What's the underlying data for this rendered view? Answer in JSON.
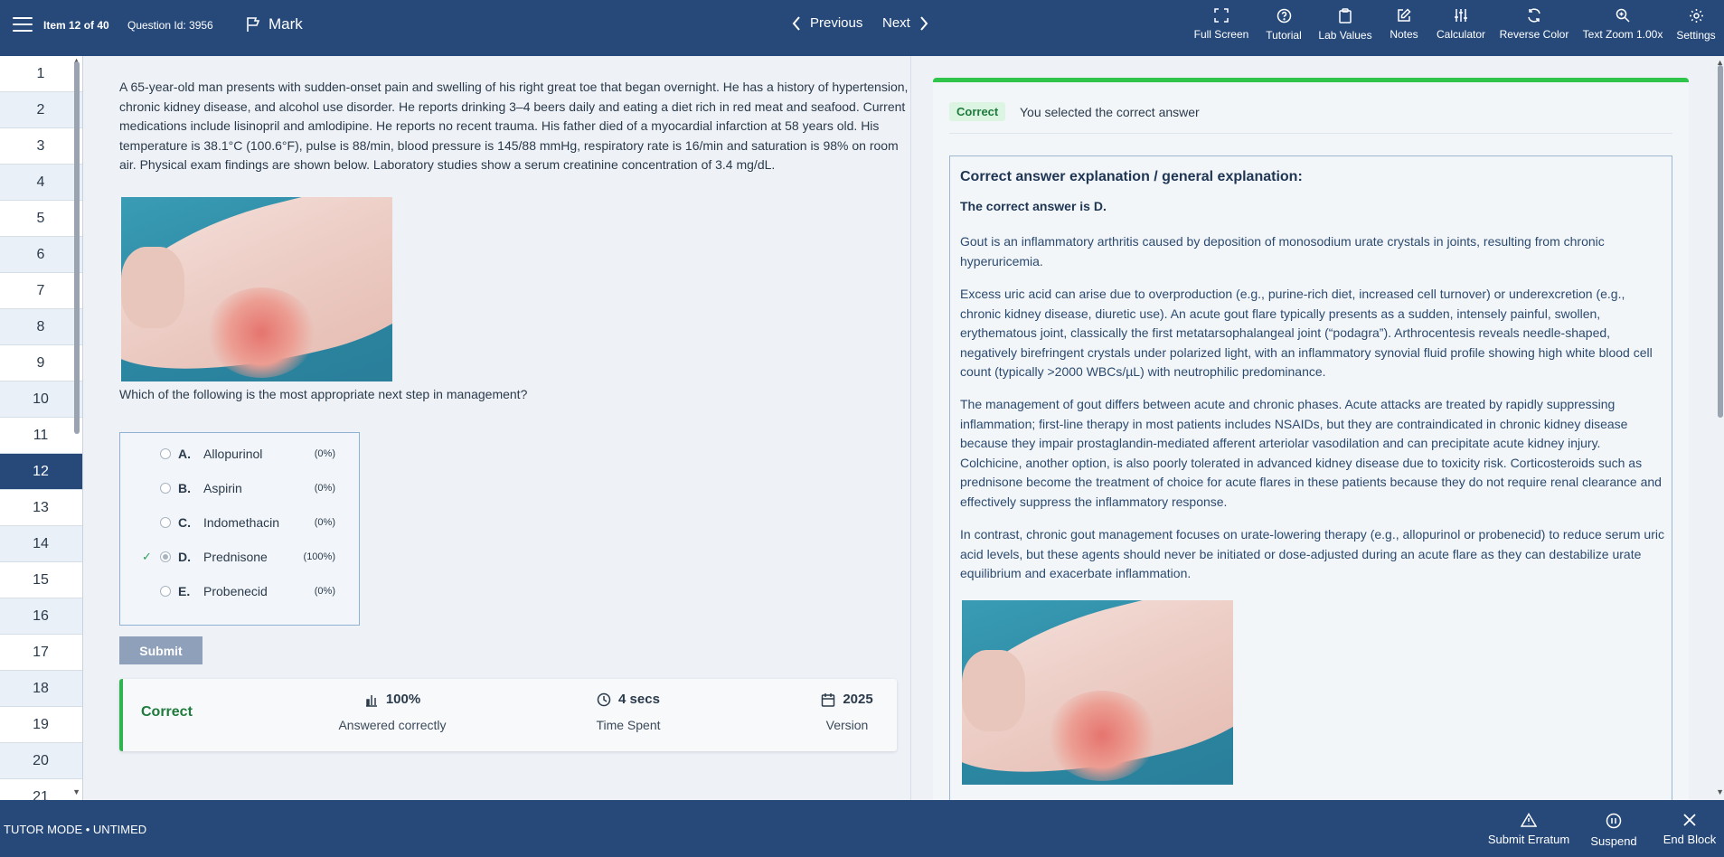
{
  "header": {
    "item_count": "Item 12 of 40",
    "question_id": "Question Id: 3956",
    "mark_label": "Mark",
    "previous_label": "Previous",
    "next_label": "Next",
    "tools": [
      {
        "label": "Full Screen",
        "icon": "fullscreen-icon"
      },
      {
        "label": "Tutorial",
        "icon": "help-circle-icon"
      },
      {
        "label": "Lab Values",
        "icon": "clipboard-icon"
      },
      {
        "label": "Notes",
        "icon": "edit-icon"
      },
      {
        "label": "Calculator",
        "icon": "sliders-icon"
      },
      {
        "label": "Reverse Color",
        "icon": "refresh-icon"
      },
      {
        "label": "Text Zoom 1.00x",
        "icon": "zoom-in-icon"
      },
      {
        "label": "Settings",
        "icon": "gear-icon"
      }
    ]
  },
  "sidebar": {
    "items": [
      "1",
      "2",
      "3",
      "4",
      "5",
      "6",
      "7",
      "8",
      "9",
      "10",
      "11",
      "12",
      "13",
      "14",
      "15",
      "16",
      "17",
      "18",
      "19",
      "20",
      "21"
    ],
    "active_index": 11
  },
  "question": {
    "stem": "A 65-year-old man presents with sudden-onset pain and swelling of his right great toe that began overnight. He has a history of hypertension, chronic kidney disease, and alcohol use disorder. He reports drinking 3–4 beers daily and eating a diet rich in red meat and seafood. Current medications include lisinopril and amlodipine. He reports no recent trauma. His father died of a myocardial infarction at 58 years old. His temperature is 38.1°C (100.6°F), pulse is 88/min, blood pressure is 145/88 mmHg, respiratory rate is 16/min and saturation is 98% on room air. Physical exam findings are shown below. Laboratory studies show a serum creatinine concentration of 3.4 mg/dL.",
    "prompt": "Which of the following is the most appropriate next step in management?",
    "choices": [
      {
        "letter": "A.",
        "text": "Allopurinol",
        "pct": "(0%)"
      },
      {
        "letter": "B.",
        "text": "Aspirin",
        "pct": "(0%)"
      },
      {
        "letter": "C.",
        "text": "Indomethacin",
        "pct": "(0%)"
      },
      {
        "letter": "D.",
        "text": "Prednisone",
        "pct": "(100%)"
      },
      {
        "letter": "E.",
        "text": "Probenecid",
        "pct": "(0%)"
      }
    ],
    "selected_letter": "D.",
    "submit_label": "Submit"
  },
  "result": {
    "status": "Correct",
    "stats": [
      {
        "value": "100%",
        "label": "Answered correctly",
        "icon": "bar-chart-icon"
      },
      {
        "value": "4 secs",
        "label": "Time Spent",
        "icon": "clock-icon"
      },
      {
        "value": "2025",
        "label": "Version",
        "icon": "calendar-icon"
      }
    ]
  },
  "explanation": {
    "badge": "Correct",
    "message": "You selected the correct answer",
    "title": "Correct answer explanation / general explanation:",
    "answer": "The correct answer is D.",
    "paragraphs": [
      "Gout is an inflammatory arthritis caused by deposition of monosodium urate crystals in joints, resulting from chronic hyperuricemia.",
      "Excess uric acid can arise due to overproduction (e.g., purine-rich diet, increased cell turnover) or underexcretion (e.g., chronic kidney disease, diuretic use). An acute gout flare typically presents as a sudden, intensely painful, swollen, erythematous joint, classically the first metatarsophalangeal joint (“podagra”). Arthrocentesis reveals needle-shaped, negatively birefringent crystals under polarized light, with an inflammatory synovial fluid profile showing high white blood cell count (typically >2000 WBCs/µL) with neutrophilic predominance.",
      "The management of gout differs between acute and chronic phases. Acute attacks are treated by rapidly suppressing inflammation; first-line therapy in most patients includes NSAIDs, but they are contraindicated in chronic kidney disease because they impair prostaglandin-mediated afferent arteriolar vasodilation and can precipitate acute kidney injury. Colchicine, another option, is also poorly tolerated in advanced kidney disease due to toxicity risk. Corticosteroids such as prednisone become the treatment of choice for acute flares in these patients because they do not require renal clearance and effectively suppress the inflammatory response.",
      "In contrast, chronic gout management focuses on urate-lowering therapy (e.g., allopurinol or probenecid) to reduce serum uric acid levels, but these agents should never be initiated or dose-adjusted during an acute flare as they can destabilize urate equilibrium and exacerbate inflammation."
    ]
  },
  "footer": {
    "mode": "TUTOR MODE  •  UNTIMED",
    "actions": [
      {
        "label": "Submit Erratum",
        "icon": "warning-icon"
      },
      {
        "label": "Suspend",
        "icon": "pause-icon"
      },
      {
        "label": "End Block",
        "icon": "close-icon"
      }
    ]
  },
  "colors": {
    "brand": "#26497a",
    "correct": "#2fb450",
    "background": "#eef2f7"
  }
}
